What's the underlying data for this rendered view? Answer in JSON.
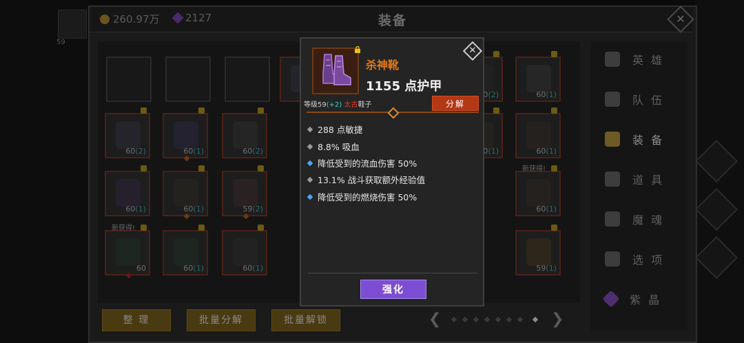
{
  "header": {
    "gold": "260.97万",
    "crystals": "2127",
    "title": "装备"
  },
  "left_panel": {
    "level_text": "59"
  },
  "grid": {
    "slots": [
      {
        "level": "",
        "plus": "",
        "empty": true
      },
      {
        "level": "",
        "plus": "",
        "empty": true
      },
      {
        "level": "",
        "plus": "",
        "empty": true
      },
      {
        "level": "60",
        "plus": "(2)"
      },
      {
        "level": "60",
        "plus": "(1)"
      },
      {
        "level": "60",
        "plus": "(2)"
      },
      {
        "level": "60",
        "plus": "(1)"
      },
      {
        "level": "60",
        "plus": "(2)"
      },
      {
        "level": "60",
        "plus": "(1)"
      },
      {
        "level": "60",
        "plus": "(1)"
      },
      {
        "level": "59",
        "plus": "(2)"
      },
      {
        "level": "60",
        "plus": "(1)"
      },
      {
        "level": "60",
        "plus": "(1)"
      },
      {
        "level": "60",
        "plus": ""
      },
      {
        "level": "60",
        "plus": "(1)"
      },
      {
        "level": "60",
        "plus": "(1)"
      },
      {
        "level": "60",
        "plus": "(1)"
      },
      {
        "level": "59",
        "plus": "(1)"
      }
    ],
    "new_label": "新获得!"
  },
  "bottom": {
    "sort": "整 理",
    "bulk_decompose": "批量分解",
    "bulk_unlock": "批量解锁"
  },
  "menu": {
    "items": [
      {
        "label": "英 雄",
        "icon": "people-icon"
      },
      {
        "label": "队 伍",
        "icon": "flag-icon"
      },
      {
        "label": "装 备",
        "icon": "helmet-icon"
      },
      {
        "label": "道 具",
        "icon": "bag-icon"
      },
      {
        "label": "魔 魂",
        "icon": "flame-icon"
      },
      {
        "label": "选 项",
        "icon": "gear-icon"
      },
      {
        "label": "紫 晶",
        "icon": "crystal-icon"
      }
    ]
  },
  "item": {
    "name": "杀神靴",
    "armor": "1155 点护甲",
    "level_prefix": "等级59",
    "level_plus": "(+2)",
    "tier": "太古",
    "type": "鞋子",
    "decompose": "分解",
    "stats": [
      {
        "text": "288 点敏捷",
        "bullet": "gray"
      },
      {
        "text": "8.8% 吸血",
        "bullet": "gray"
      },
      {
        "text": "降低受到的流血伤害 50%",
        "bullet": "blue"
      },
      {
        "text": "13.1% 战斗获取额外经验值",
        "bullet": "gray"
      },
      {
        "text": "降低受到的燃烧伤害 50%",
        "bullet": "blue"
      }
    ],
    "strengthen": "强化"
  },
  "colors": {
    "item_name": "#e27a1a",
    "decompose_bg": "#b33816",
    "strengthen_bg": "#7c4ed3",
    "plus_cyan": "#3fd1c8",
    "tier_red": "#e23b2b"
  }
}
